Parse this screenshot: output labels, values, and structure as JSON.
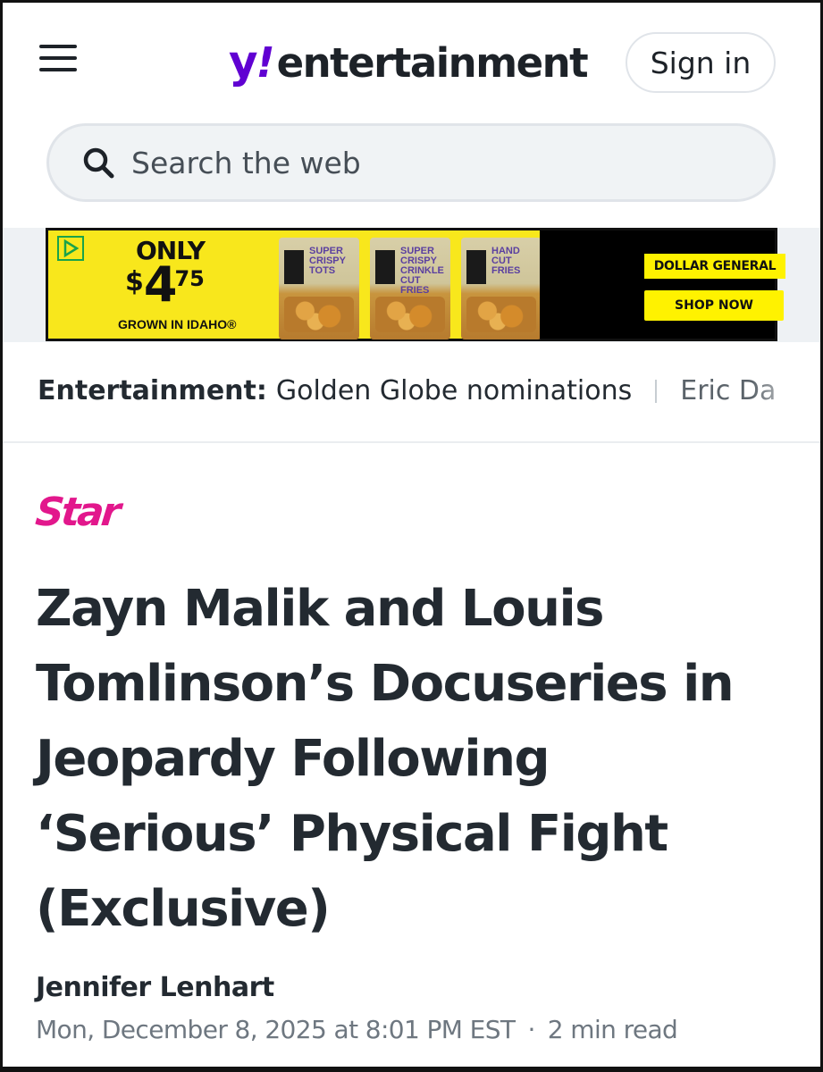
{
  "header": {
    "logo": {
      "y": "y",
      "bang": "!",
      "word": "entertainment"
    },
    "signin_label": "Sign in",
    "menu_icon": "hamburger-menu-icon"
  },
  "search": {
    "placeholder": "Search the web",
    "icon": "search-icon"
  },
  "ad": {
    "only": "ONLY",
    "price_currency": "$",
    "price_dollars": "4",
    "price_cents": "75",
    "grown": "GROWN IN IDAHO®",
    "bags": [
      {
        "label": "SUPER CRISPY TOTS"
      },
      {
        "label": "SUPER CRISPY CRINKLE CUT FRIES"
      },
      {
        "label": "HAND CUT FRIES"
      }
    ],
    "brand": "DOLLAR GENERAL",
    "cta": "SHOP NOW",
    "colors": {
      "yellow": "#f8e71c",
      "black": "#000000",
      "dg_yellow": "#fff200"
    }
  },
  "topics": {
    "label": "Entertainment:",
    "items": [
      "Golden Globe nominations",
      "Eric Da"
    ]
  },
  "article": {
    "publisher": "Star",
    "headline": "Zayn Malik and Louis Tomlinson’s Docuseries in Jeopardy Following ‘Serious’ Physical Fight (Exclusive)",
    "author": "Jennifer Lenhart",
    "date": "Mon, December 8, 2025 at 8:01 PM EST",
    "separator": "·",
    "read_time": "2 min read"
  },
  "colors": {
    "brand_purple": "#6001d2",
    "star_pink": "#e2178c",
    "text": "#232a31",
    "meta": "#6e7780"
  }
}
